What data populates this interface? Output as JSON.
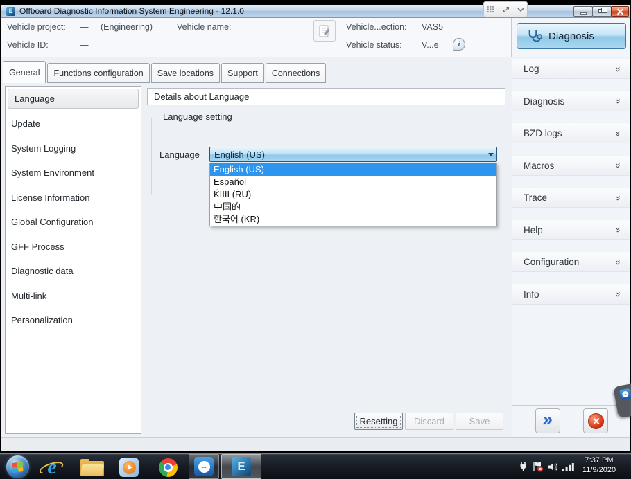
{
  "window": {
    "title": "Offboard Diagnostic Information System Engineering - 12.1.0"
  },
  "header": {
    "vehicle_project_label": "Vehicle project:",
    "vehicle_project_value": "—",
    "engineering": "(Engineering)",
    "vehicle_name_label": "Vehicle name:",
    "vehicle_id_label": "Vehicle ID:",
    "vehicle_id_value": "—",
    "connection_label": "Vehicle...ection:",
    "connection_value": "VAS5",
    "status_label": "Vehicle status:",
    "status_value": "V...e",
    "diagnosis_label": "Diagnosis"
  },
  "tabs": [
    {
      "label": "General"
    },
    {
      "label": "Functions configuration"
    },
    {
      "label": "Save locations"
    },
    {
      "label": "Support"
    },
    {
      "label": "Connections"
    }
  ],
  "sidebar": {
    "items": [
      {
        "label": "Language"
      },
      {
        "label": "Update"
      },
      {
        "label": "System Logging"
      },
      {
        "label": "System Environment"
      },
      {
        "label": "License Information"
      },
      {
        "label": "Global Configuration"
      },
      {
        "label": "GFF Process"
      },
      {
        "label": "Diagnostic data"
      },
      {
        "label": "Multi-link"
      },
      {
        "label": "Personalization"
      }
    ]
  },
  "main": {
    "details_title": "Details about Language",
    "group_title": "Language setting",
    "language_label": "Language",
    "combo_value": "English (US)",
    "options": [
      {
        "label": "English (US)"
      },
      {
        "label": "Español"
      },
      {
        "label": "ḰIIII (RU)"
      },
      {
        "label": "中国的"
      },
      {
        "label": "한국어 (KR)"
      }
    ],
    "buttons": {
      "resetting": "Resetting",
      "discard": "Discard",
      "save": "Save"
    }
  },
  "right_panel": {
    "sections": [
      {
        "label": "Log"
      },
      {
        "label": "Diagnosis"
      },
      {
        "label": "BZD logs"
      },
      {
        "label": "Macros"
      },
      {
        "label": "Trace"
      },
      {
        "label": "Help"
      },
      {
        "label": "Configuration"
      },
      {
        "label": "Info"
      }
    ]
  },
  "taskbar": {
    "clock_time": "7:37 PM",
    "clock_date": "11/9/2020"
  },
  "icons": {
    "info": "i",
    "chevron_double": "»",
    "forward": "»",
    "ie_glyph": "e",
    "odis_glyph": "E",
    "tv_glyph": "↔"
  },
  "colors": {
    "selection_blue": "#2e95ee",
    "combo_border": "#26567e",
    "diagnosis_blue": "#8fc8e9",
    "close_red": "#d62f10",
    "titlebar_blue": "#bdd3ea"
  }
}
